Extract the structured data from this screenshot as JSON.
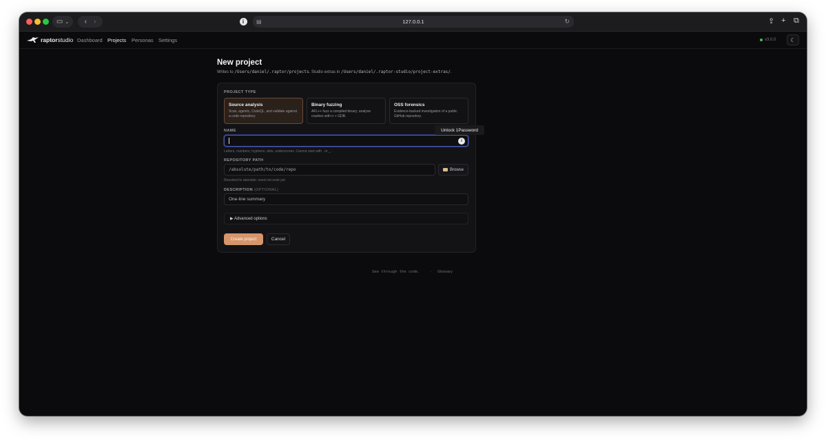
{
  "browser": {
    "url": "127.0.0.1",
    "onepassword_tooltip": "Unlock 1Password"
  },
  "app": {
    "brand_prefix": "raptor",
    "brand_suffix": "studio",
    "nav": [
      "Dashboard",
      "Projects",
      "Personas",
      "Settings"
    ],
    "active_nav": "Projects",
    "version": "v3.0.0",
    "status_color": "#3fbf5a"
  },
  "page": {
    "title": "New project",
    "subtitle_prefix": "Writes to ",
    "subtitle_path1": "/Users/daniel/.raptor/projects",
    "subtitle_mid": ". Studio extras in ",
    "subtitle_path2": "/Users/daniel/.raptor-studio/project-extras/",
    "subtitle_end": "."
  },
  "form": {
    "project_type_label": "PROJECT TYPE",
    "project_types": [
      {
        "title": "Source analysis",
        "desc": "Scan, agentic, CodeQL, and validate against a code repository.",
        "selected": true
      },
      {
        "title": "Binary fuzzing",
        "desc": "AFL++ fuzz a compiled binary; analyse crashes with rr + GDB.",
        "selected": false
      },
      {
        "title": "OSS forensics",
        "desc": "Evidence-backed investigation of a public GitHub repository.",
        "selected": false
      }
    ],
    "name_label": "NAME",
    "name_value": "",
    "name_help": "Letters, numbers, hyphens, dots, underscores. Cannot start with . or _.",
    "repo_label": "REPOSITORY PATH",
    "repo_placeholder": "/absolute/path/to/code/repo",
    "browse_label": "Browse",
    "repo_help": "Resolved to absolute; need not exist yet.",
    "desc_label": "DESCRIPTION",
    "desc_optional": "(OPTIONAL)",
    "desc_placeholder": "One-line summary",
    "advanced_label": "▶ Advanced options",
    "create_label": "Create project",
    "cancel_label": "Cancel",
    "accent_color": "#d6956a"
  },
  "footer": {
    "tagline": "See through the code.",
    "separator": "·",
    "glossary": "Glossary"
  }
}
